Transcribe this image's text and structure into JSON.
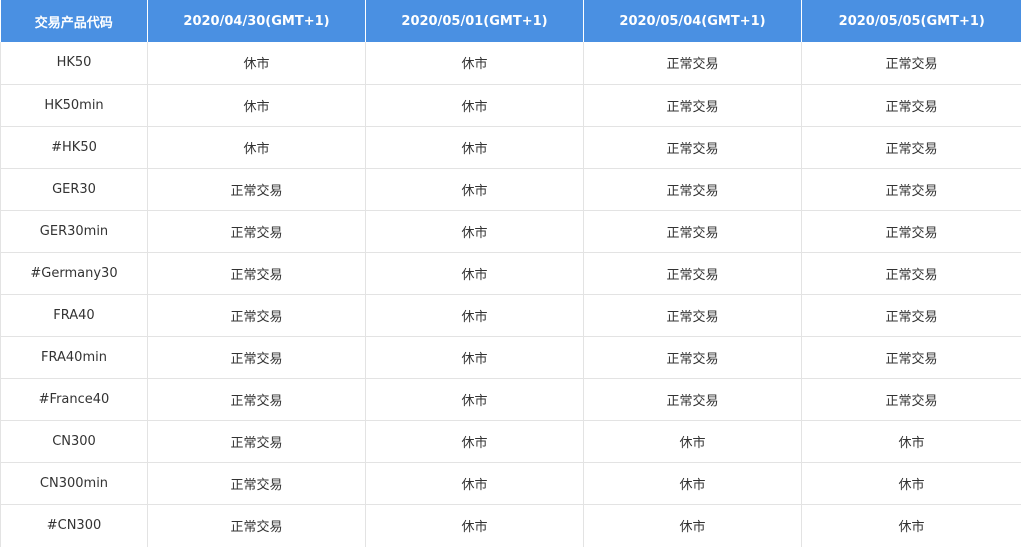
{
  "colors": {
    "header_bg": "#4a90e2",
    "header_text": "#ffffff",
    "cell_text": "#333333",
    "grid_line": "#e3e3e3"
  },
  "table": {
    "headers": [
      "交易产品代码",
      "2020/04/30(GMT+1)",
      "2020/05/01(GMT+1)",
      "2020/05/04(GMT+1)",
      "2020/05/05(GMT+1)"
    ],
    "rows": [
      [
        "HK50",
        "休市",
        "休市",
        "正常交易",
        "正常交易"
      ],
      [
        "HK50min",
        "休市",
        "休市",
        "正常交易",
        "正常交易"
      ],
      [
        "#HK50",
        "休市",
        "休市",
        "正常交易",
        "正常交易"
      ],
      [
        "GER30",
        "正常交易",
        "休市",
        "正常交易",
        "正常交易"
      ],
      [
        "GER30min",
        "正常交易",
        "休市",
        "正常交易",
        "正常交易"
      ],
      [
        "#Germany30",
        "正常交易",
        "休市",
        "正常交易",
        "正常交易"
      ],
      [
        "FRA40",
        "正常交易",
        "休市",
        "正常交易",
        "正常交易"
      ],
      [
        "FRA40min",
        "正常交易",
        "休市",
        "正常交易",
        "正常交易"
      ],
      [
        "#France40",
        "正常交易",
        "休市",
        "正常交易",
        "正常交易"
      ],
      [
        "CN300",
        "正常交易",
        "休市",
        "休市",
        "休市"
      ],
      [
        "CN300min",
        "正常交易",
        "休市",
        "休市",
        "休市"
      ],
      [
        "#CN300",
        "正常交易",
        "休市",
        "休市",
        "休市"
      ]
    ]
  }
}
